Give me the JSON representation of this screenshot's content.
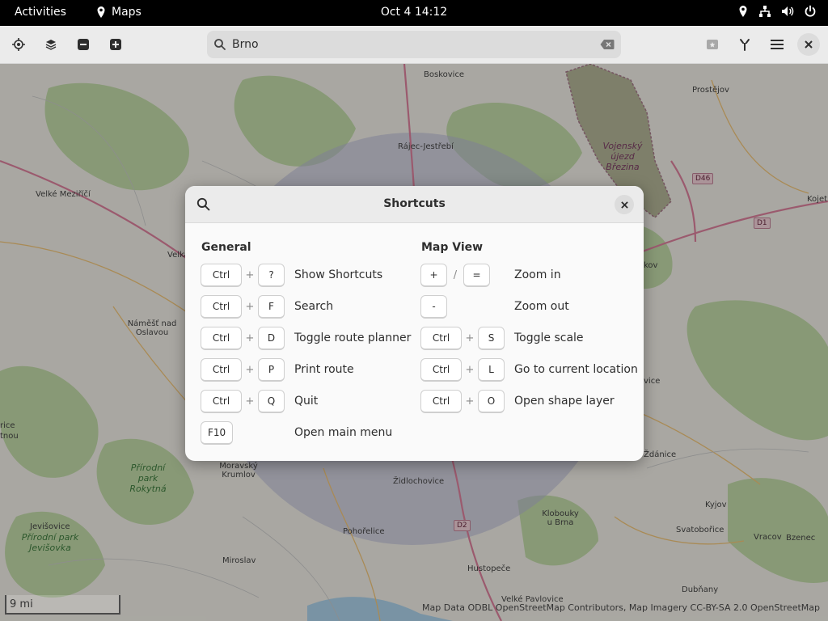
{
  "topbar": {
    "activities": "Activities",
    "app_name": "Maps",
    "clock": "Oct 4  14:12"
  },
  "headerbar": {
    "search_value": "Brno"
  },
  "map": {
    "labels": [
      {
        "text": "Boskovice",
        "cls": ""
      },
      {
        "text": "Prostějov",
        "cls": ""
      },
      {
        "text": "Rájec-Jestřebí",
        "cls": ""
      },
      {
        "text": "Vojenský újezd Březina",
        "cls": "purple"
      },
      {
        "text": "Velké Meziříčí",
        "cls": ""
      },
      {
        "text": "Velka",
        "cls": ""
      },
      {
        "text": "Kojet",
        "cls": ""
      },
      {
        "text": "kov",
        "cls": ""
      },
      {
        "text": "Náměšť nad Oslavou",
        "cls": ""
      },
      {
        "text": "vice",
        "cls": ""
      },
      {
        "text": "rice",
        "cls": ""
      },
      {
        "text": "tnou",
        "cls": ""
      },
      {
        "text": "Ždánice",
        "cls": ""
      },
      {
        "text": "Přírodní park Rokytná",
        "cls": "green"
      },
      {
        "text": "Moravský Krumlov",
        "cls": ""
      },
      {
        "text": "Židlochovice",
        "cls": ""
      },
      {
        "text": "Jevišovice",
        "cls": ""
      },
      {
        "text": "Přírodní park Jevišovka",
        "cls": "green"
      },
      {
        "text": "Pohořelice",
        "cls": ""
      },
      {
        "text": "Klobouky u Brna",
        "cls": ""
      },
      {
        "text": "Kyjov",
        "cls": ""
      },
      {
        "text": "Svatobořice",
        "cls": ""
      },
      {
        "text": "Vracov",
        "cls": ""
      },
      {
        "text": "Bzenec",
        "cls": ""
      },
      {
        "text": "Miroslav",
        "cls": ""
      },
      {
        "text": "Hustopeče",
        "cls": ""
      },
      {
        "text": "Dubňany",
        "cls": ""
      },
      {
        "text": "Velké Pavlovice",
        "cls": ""
      }
    ],
    "road_badges": [
      "D46",
      "D1",
      "D2"
    ],
    "scale": "9 mi",
    "attribution": "Map Data ODBL OpenStreetMap Contributors, Map Imagery CC-BY-SA 2.0 OpenStreetMap"
  },
  "dialog": {
    "title": "Shortcuts",
    "sections": [
      {
        "title": "General",
        "shortcuts": [
          {
            "keys": [
              "Ctrl",
              "?"
            ],
            "sep": "+",
            "desc": "Show Shortcuts"
          },
          {
            "keys": [
              "Ctrl",
              "F"
            ],
            "sep": "+",
            "desc": "Search"
          },
          {
            "keys": [
              "Ctrl",
              "D"
            ],
            "sep": "+",
            "desc": "Toggle route planner"
          },
          {
            "keys": [
              "Ctrl",
              "P"
            ],
            "sep": "+",
            "desc": "Print route"
          },
          {
            "keys": [
              "Ctrl",
              "Q"
            ],
            "sep": "+",
            "desc": "Quit"
          },
          {
            "keys": [
              "F10"
            ],
            "sep": "",
            "desc": "Open main menu"
          }
        ]
      },
      {
        "title": "Map View",
        "shortcuts": [
          {
            "keys": [
              "+",
              "="
            ],
            "sep": "/",
            "desc": "Zoom in"
          },
          {
            "keys": [
              "-"
            ],
            "sep": "",
            "desc": "Zoom out"
          },
          {
            "keys": [
              "Ctrl",
              "S"
            ],
            "sep": "+",
            "desc": "Toggle scale"
          },
          {
            "keys": [
              "Ctrl",
              "L"
            ],
            "sep": "+",
            "desc": "Go to current location"
          },
          {
            "keys": [
              "Ctrl",
              "O"
            ],
            "sep": "+",
            "desc": "Open shape layer"
          }
        ]
      }
    ]
  },
  "colors": {
    "accent_close": "#2e2e2e",
    "map_land": "#e6e4dc",
    "forest": "#b5cf9b",
    "road": "#d17290"
  }
}
